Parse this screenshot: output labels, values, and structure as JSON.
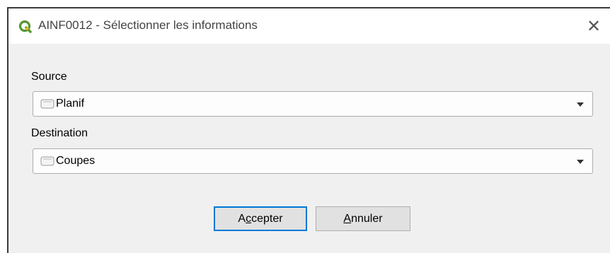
{
  "window": {
    "title": "AINF0012 - Sélectionner les informations",
    "close_glyph": "✕",
    "app_icon": "qgis-logo-icon"
  },
  "form": {
    "source_label": "Source",
    "source_value": "Planif",
    "destination_label": "Destination",
    "destination_value": "Coupes",
    "layer_icon": "group-folder-icon"
  },
  "buttons": {
    "accept_pre": "A",
    "accept_mnemonic": "c",
    "accept_post": "cepter",
    "cancel_mnemonic": "A",
    "cancel_post": "nnuler"
  },
  "colors": {
    "accent": "#0078d7",
    "qgis_green": "#589632",
    "qgis_yellow": "#eeb81b"
  }
}
